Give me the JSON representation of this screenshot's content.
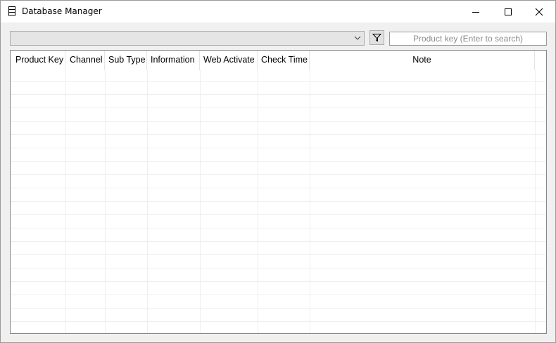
{
  "window": {
    "title": "Database Manager",
    "app_icon": "database-icon",
    "controls": [
      "minimize-icon",
      "maximize-icon",
      "close-icon"
    ]
  },
  "toolbar": {
    "combo_value": "",
    "filter_icon": "filter-icon",
    "search_placeholder": "Product key (Enter to search)"
  },
  "table": {
    "columns": [
      {
        "label": "Product Key"
      },
      {
        "label": "Channel"
      },
      {
        "label": "Sub Type"
      },
      {
        "label": "Information"
      },
      {
        "label": "Web Activate"
      },
      {
        "label": "Check Time"
      },
      {
        "label": "Note"
      }
    ],
    "rows": []
  },
  "colors": {
    "window_bg": "#f0f0f0",
    "titlebar_bg": "#ffffff",
    "grid_line": "#eeeeee",
    "border": "#828790"
  }
}
